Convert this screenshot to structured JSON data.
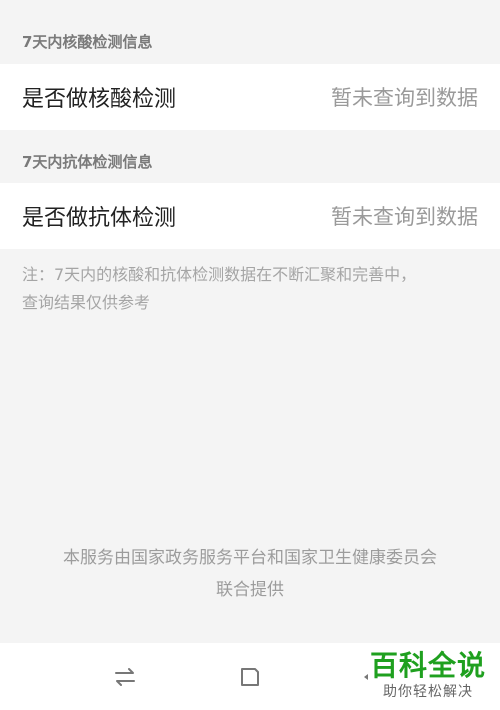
{
  "nucleic": {
    "header": "7天内核酸检测信息",
    "label": "是否做核酸检测",
    "value": "暂未查询到数据"
  },
  "antibody": {
    "header": "7天内抗体检测信息",
    "label": "是否做抗体检测",
    "value": "暂未查询到数据"
  },
  "note": {
    "line1": "注：7天内的核酸和抗体检测数据在不断汇聚和完善中，",
    "line2": "查询结果仅供参考"
  },
  "footer": {
    "line1": "本服务由国家政务服务平台和国家卫生健康委员会",
    "line2": "联合提供"
  },
  "navbar": {
    "icons": [
      "switch-apps-icon",
      "home-square-icon",
      "back-triangle-icon"
    ]
  },
  "watermark": {
    "title": "百科全说",
    "subtitle": "助你轻松解决"
  }
}
